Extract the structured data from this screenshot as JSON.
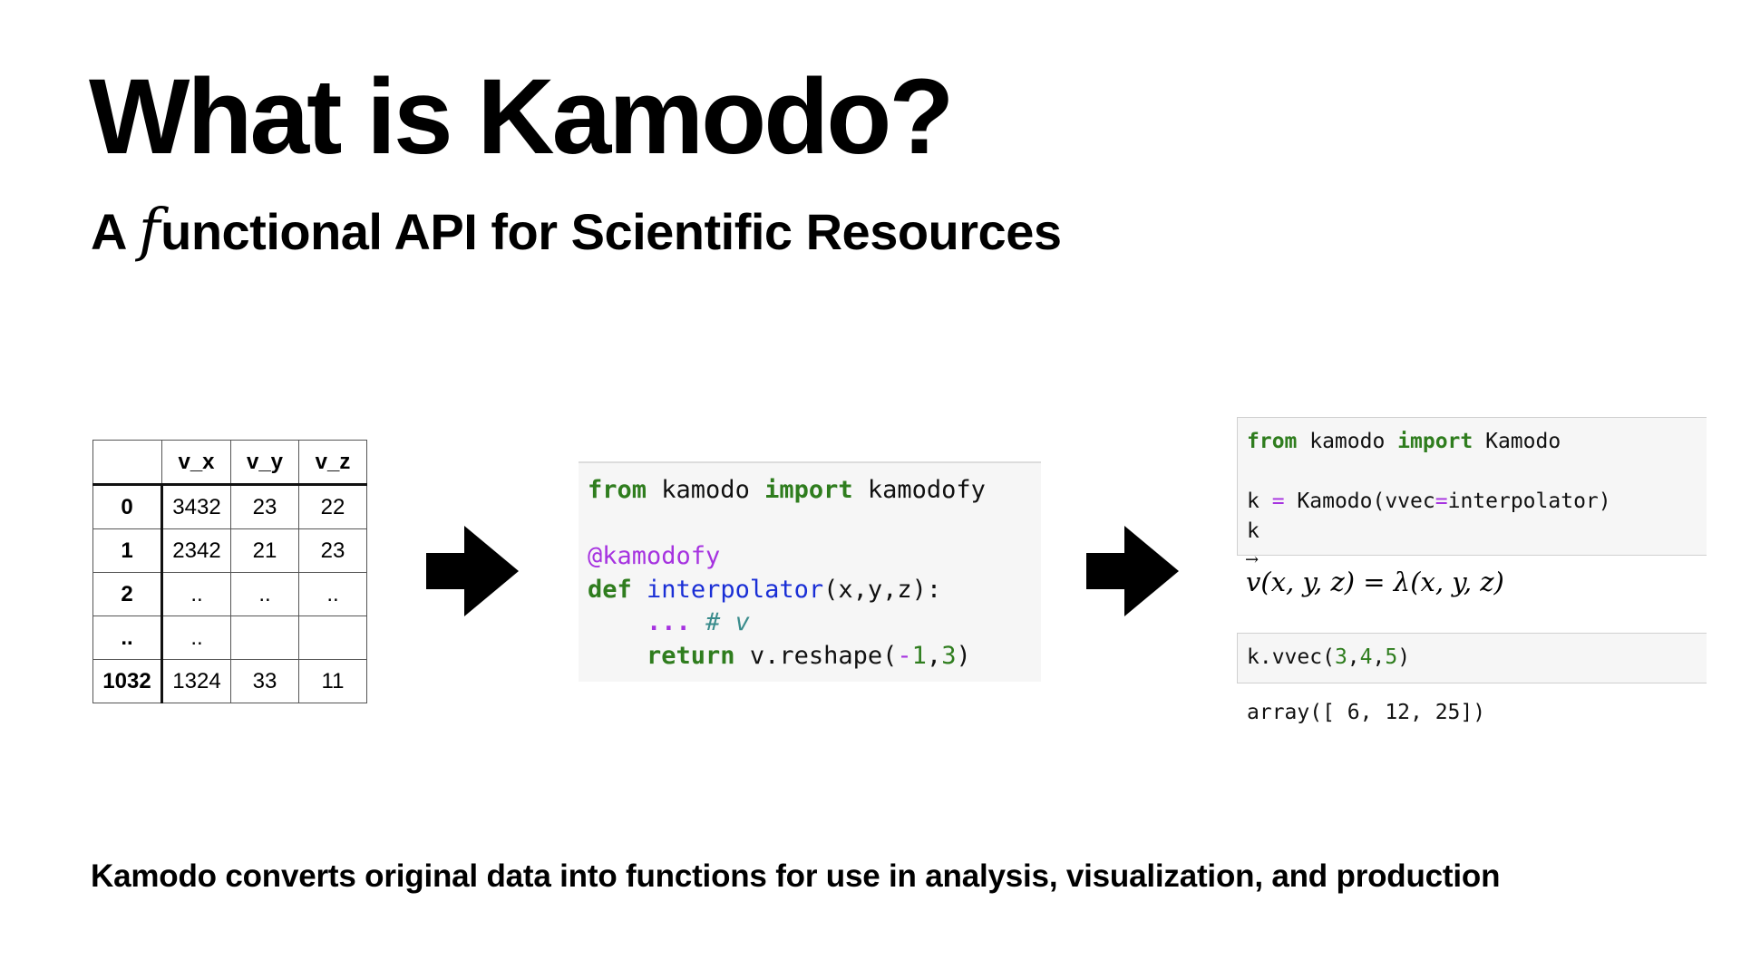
{
  "slide": {
    "title": "What is Kamodo?",
    "subtitle_lead": "A ",
    "subtitle_f": "f",
    "subtitle_rest": "unctional API for Scientific Resources",
    "footer": "Kamodo converts original data into functions for use in analysis, visualization, and production"
  },
  "table": {
    "columns": [
      "",
      "v_x",
      "v_y",
      "v_z"
    ],
    "rows": [
      {
        "index": "0",
        "cells": [
          "3432",
          "23",
          "22"
        ]
      },
      {
        "index": "1",
        "cells": [
          "2342",
          "21",
          "23"
        ]
      },
      {
        "index": "2",
        "cells": [
          "..",
          "..",
          ".."
        ]
      },
      {
        "index": "..",
        "cells": [
          "..",
          "",
          ""
        ]
      },
      {
        "index": "1032",
        "cells": [
          "1324",
          "33",
          "11"
        ]
      }
    ]
  },
  "code_mid": {
    "l1_from": "from",
    "l1_mod": " kamodo ",
    "l1_import": "import",
    "l1_name": " kamodofy",
    "l3_decorator": "@kamodofy",
    "l4_def": "def",
    "l4_fn": "interpolator",
    "l4_args": "(x,y,z):",
    "l5_ellipsis": "...",
    "l5_comment": "# v",
    "l6_return": "return",
    "l6_expr": " v.reshape(",
    "l6_minus": "-",
    "l6_n1": "1",
    "l6_comma": ",",
    "l6_n3": "3",
    "l6_close": ")"
  },
  "cell1": {
    "l1_from": "from",
    "l1_mod": " kamodo ",
    "l1_import": "import",
    "l1_name": " Kamodo",
    "l3_a": "k ",
    "l3_eq": "=",
    "l3_b": " Kamodo(vvec",
    "l3_eq2": "=",
    "l3_c": "interpolator)",
    "l4": "k"
  },
  "math_out": {
    "v": "v",
    "lhs_args": "(x, y, z) = ",
    "lambda": "λ",
    "rhs_args": "(x, y, z)"
  },
  "cell2": {
    "pre": "k.vvec(",
    "n1": "3",
    "c1": ",",
    "n2": "4",
    "c2": ",",
    "n3": "5",
    "post": ")"
  },
  "output": {
    "array": "array([ 6, 12, 25])"
  },
  "colors": {
    "keyword": "#2f7d1e",
    "function": "#1a2fd6",
    "decorator": "#a633e0",
    "comment": "#3a8c8c",
    "code_bg": "#f6f6f6"
  },
  "icons": [
    "right-arrow-icon",
    "right-arrow-icon"
  ]
}
